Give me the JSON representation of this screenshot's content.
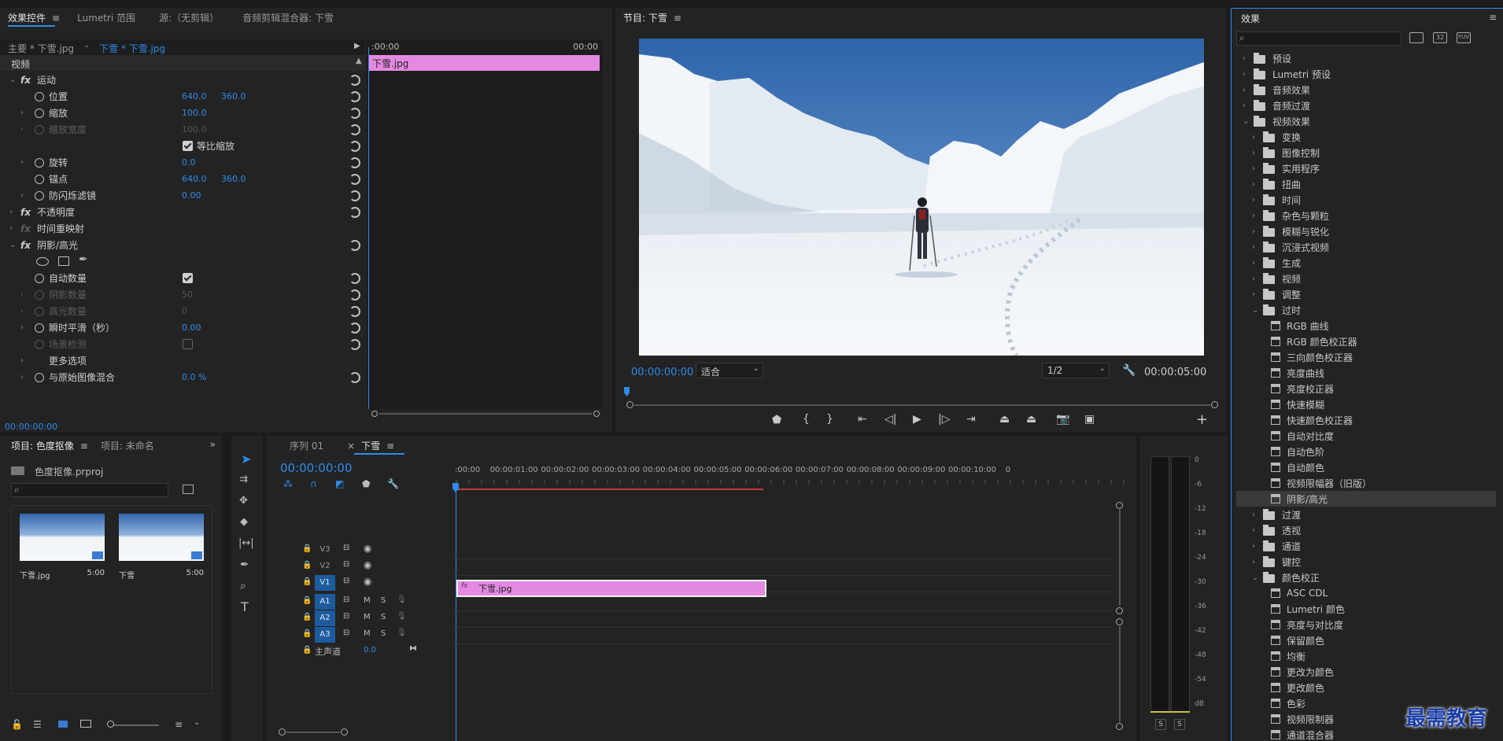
{
  "effect_controls": {
    "tabs": [
      {
        "label": "效果控件",
        "active": true
      },
      {
        "label": "Lumetri 范围"
      },
      {
        "label": "源:（无剪辑）"
      },
      {
        "label": "音频剪辑混合器: 下雪"
      }
    ],
    "master_clip": "主要 * 下雪.jpg",
    "seq_clip": "下雪 * 下雪.jpg",
    "time_start": ":00:00",
    "time_end": "00:00",
    "clip_label": "下雪.jpg",
    "section": "视频",
    "rows": {
      "motion": "运动",
      "position": "位置",
      "position_x": "640.0",
      "position_y": "360.0",
      "scale": "缩放",
      "scale_val": "100.0",
      "scale_width": "缩放宽度",
      "scale_width_val": "100.0",
      "uniform_scale": "等比缩放",
      "rotation": "旋转",
      "rotation_val": "0.0",
      "anchor": "锚点",
      "anchor_x": "640.0",
      "anchor_y": "360.0",
      "anti_flicker": "防闪烁滤镜",
      "anti_flicker_val": "0.00",
      "opacity": "不透明度",
      "time_remap": "时间重映射",
      "shadow_highlight": "阴影/高光",
      "auto_amount": "自动数量",
      "shadow_amount": "阴影数量",
      "shadow_amount_val": "50",
      "highlight_amount": "高光数量",
      "highlight_amount_val": "0",
      "temporal_smooth": "瞬时平滑（秒）",
      "temporal_smooth_val": "0.00",
      "scene_detect": "场景检测",
      "more_options": "更多选项",
      "blend": "与原始图像混合",
      "blend_val": "0.0 %"
    },
    "timecode": "00:00:00:00"
  },
  "program": {
    "title": "节目: 下雪",
    "timecode": "00:00:00:00",
    "fit": "适合",
    "resolution": "1/2",
    "duration": "00:00:05:00"
  },
  "effects": {
    "title": "效果",
    "items": [
      {
        "label": "预设",
        "level": 0,
        "type": "folder",
        "open": false,
        "star": true
      },
      {
        "label": "Lumetri 预设",
        "level": 0,
        "type": "folder",
        "open": false,
        "star": true
      },
      {
        "label": "音频效果",
        "level": 0,
        "type": "folder",
        "open": false
      },
      {
        "label": "音频过渡",
        "level": 0,
        "type": "folder",
        "open": false
      },
      {
        "label": "视频效果",
        "level": 0,
        "type": "folder",
        "open": true
      },
      {
        "label": "变换",
        "level": 1,
        "type": "folder",
        "open": false
      },
      {
        "label": "图像控制",
        "level": 1,
        "type": "folder",
        "open": false
      },
      {
        "label": "实用程序",
        "level": 1,
        "type": "folder",
        "open": false
      },
      {
        "label": "扭曲",
        "level": 1,
        "type": "folder",
        "open": false
      },
      {
        "label": "时间",
        "level": 1,
        "type": "folder",
        "open": false
      },
      {
        "label": "杂色与颗粒",
        "level": 1,
        "type": "folder",
        "open": false
      },
      {
        "label": "模糊与锐化",
        "level": 1,
        "type": "folder",
        "open": false
      },
      {
        "label": "沉浸式视频",
        "level": 1,
        "type": "folder",
        "open": false
      },
      {
        "label": "生成",
        "level": 1,
        "type": "folder",
        "open": false
      },
      {
        "label": "视频",
        "level": 1,
        "type": "folder",
        "open": false
      },
      {
        "label": "调整",
        "level": 1,
        "type": "folder",
        "open": false
      },
      {
        "label": "过时",
        "level": 1,
        "type": "folder",
        "open": true
      },
      {
        "label": "RGB 曲线",
        "level": 2,
        "type": "fx"
      },
      {
        "label": "RGB 颜色校正器",
        "level": 2,
        "type": "fx"
      },
      {
        "label": "三向颜色校正器",
        "level": 2,
        "type": "fx"
      },
      {
        "label": "亮度曲线",
        "level": 2,
        "type": "fx"
      },
      {
        "label": "亮度校正器",
        "level": 2,
        "type": "fx"
      },
      {
        "label": "快速模糊",
        "level": 2,
        "type": "fx"
      },
      {
        "label": "快速颜色校正器",
        "level": 2,
        "type": "fx"
      },
      {
        "label": "自动对比度",
        "level": 2,
        "type": "fx"
      },
      {
        "label": "自动色阶",
        "level": 2,
        "type": "fx"
      },
      {
        "label": "自动颜色",
        "level": 2,
        "type": "fx"
      },
      {
        "label": "视频限幅器（旧版）",
        "level": 2,
        "type": "fx"
      },
      {
        "label": "阴影/高光",
        "level": 2,
        "type": "fx",
        "selected": true
      },
      {
        "label": "过渡",
        "level": 1,
        "type": "folder",
        "open": false
      },
      {
        "label": "透视",
        "level": 1,
        "type": "folder",
        "open": false
      },
      {
        "label": "通道",
        "level": 1,
        "type": "folder",
        "open": false
      },
      {
        "label": "键控",
        "level": 1,
        "type": "folder",
        "open": false
      },
      {
        "label": "颜色校正",
        "level": 1,
        "type": "folder",
        "open": true
      },
      {
        "label": "ASC CDL",
        "level": 2,
        "type": "fx"
      },
      {
        "label": "Lumetri 颜色",
        "level": 2,
        "type": "fx"
      },
      {
        "label": "亮度与对比度",
        "level": 2,
        "type": "fx"
      },
      {
        "label": "保留颜色",
        "level": 2,
        "type": "fx"
      },
      {
        "label": "均衡",
        "level": 2,
        "type": "fx"
      },
      {
        "label": "更改为颜色",
        "level": 2,
        "type": "fx"
      },
      {
        "label": "更改颜色",
        "level": 2,
        "type": "fx"
      },
      {
        "label": "色彩",
        "level": 2,
        "type": "fx"
      },
      {
        "label": "视频限制器",
        "level": 2,
        "type": "fx"
      },
      {
        "label": "通道混合器",
        "level": 2,
        "type": "fx"
      }
    ]
  },
  "project": {
    "tab1": "项目: 色度抠像",
    "tab2": "项目: 未命名",
    "file": "色度抠像.prproj",
    "items": [
      {
        "name": "下雪.jpg",
        "dur": "5:00"
      },
      {
        "name": "下雪",
        "dur": "5:00"
      }
    ]
  },
  "timeline": {
    "tabs": [
      {
        "label": "序列 01"
      },
      {
        "label": "下雪",
        "active": true
      }
    ],
    "timecode": "00:00:00:00",
    "ruler": [
      ":00:00",
      "00:00:01:00",
      "00:00:02:00",
      "00:00:03:00",
      "00:00:04:00",
      "00:00:05:00",
      "00:00:06:00",
      "00:00:07:00",
      "00:00:08:00",
      "00:00:09:00",
      "00:00:10:00",
      "0"
    ],
    "tracks": [
      "V3",
      "V2",
      "V1",
      "A1",
      "A2",
      "A3"
    ],
    "m": "M",
    "s": "S",
    "master": "主声道",
    "master_val": "0.0",
    "clip": "下雪.jpg"
  },
  "meter": {
    "labels": [
      "0",
      "-6",
      "-12",
      "-18",
      "-24",
      "-30",
      "-36",
      "-42",
      "-48",
      "-54",
      "dB"
    ],
    "solo": [
      "S",
      "S"
    ]
  },
  "watermark": "最需教育"
}
